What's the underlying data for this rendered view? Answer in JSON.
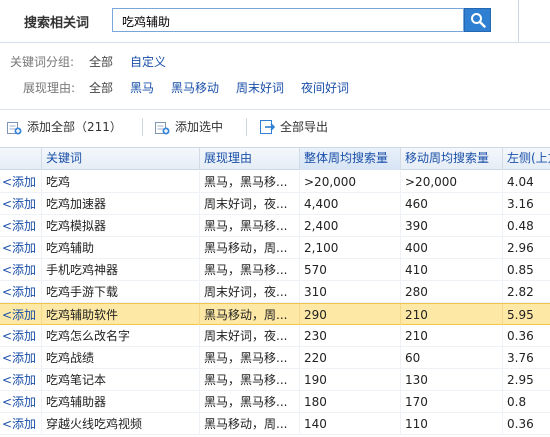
{
  "search": {
    "title": "搜索相关词",
    "value": "吃鸡辅助",
    "button_icon": "search-icon"
  },
  "filters": {
    "group": {
      "label": "关键词分组:",
      "all": "全部",
      "options": [
        "自定义"
      ]
    },
    "reason": {
      "label": "展现理由:",
      "all": "全部",
      "options": [
        "黑马",
        "黑马移动",
        "周末好词",
        "夜间好词"
      ]
    }
  },
  "toolbar": {
    "add_all": "添加全部（211）",
    "add_selected": "添加选中",
    "export_all": "全部导出"
  },
  "table": {
    "columns": [
      "",
      "关键词",
      "展现理由",
      "整体周均搜索量",
      "移动周均搜索量",
      "左侧(上方"
    ],
    "add_label": "<添加",
    "rows": [
      {
        "keyword": "吃鸡",
        "reason": "黑马，黑马移...",
        "total": ">20,000",
        "mobile": ">20,000",
        "left": "4.04"
      },
      {
        "keyword": "吃鸡加速器",
        "reason": "周末好词，夜...",
        "total": "4,400",
        "mobile": "460",
        "left": "3.16"
      },
      {
        "keyword": "吃鸡模拟器",
        "reason": "黑马，黑马移...",
        "total": "2,400",
        "mobile": "390",
        "left": "0.48"
      },
      {
        "keyword": "吃鸡辅助",
        "reason": "黑马移动，周...",
        "total": "2,100",
        "mobile": "400",
        "left": "2.96"
      },
      {
        "keyword": "手机吃鸡神器",
        "reason": "黑马，黑马移...",
        "total": "570",
        "mobile": "410",
        "left": "0.85"
      },
      {
        "keyword": "吃鸡手游下载",
        "reason": "周末好词，夜...",
        "total": "310",
        "mobile": "280",
        "left": "2.82"
      },
      {
        "keyword": "吃鸡辅助软件",
        "reason": "黑马移动，周...",
        "total": "290",
        "mobile": "210",
        "left": "5.95"
      },
      {
        "keyword": "吃鸡怎么改名字",
        "reason": "周末好词，夜...",
        "total": "230",
        "mobile": "210",
        "left": "0.36"
      },
      {
        "keyword": "吃鸡战绩",
        "reason": "黑马，黑马移...",
        "total": "220",
        "mobile": "60",
        "left": "3.76"
      },
      {
        "keyword": "吃鸡笔记本",
        "reason": "黑马，黑马移...",
        "total": "190",
        "mobile": "130",
        "left": "2.95"
      },
      {
        "keyword": "吃鸡辅助器",
        "reason": "黑马，黑马移...",
        "total": "180",
        "mobile": "170",
        "left": "0.8"
      },
      {
        "keyword": "穿越火线吃鸡视频",
        "reason": "黑马移动，周...",
        "total": "140",
        "mobile": "110",
        "left": "0.36"
      }
    ]
  }
}
